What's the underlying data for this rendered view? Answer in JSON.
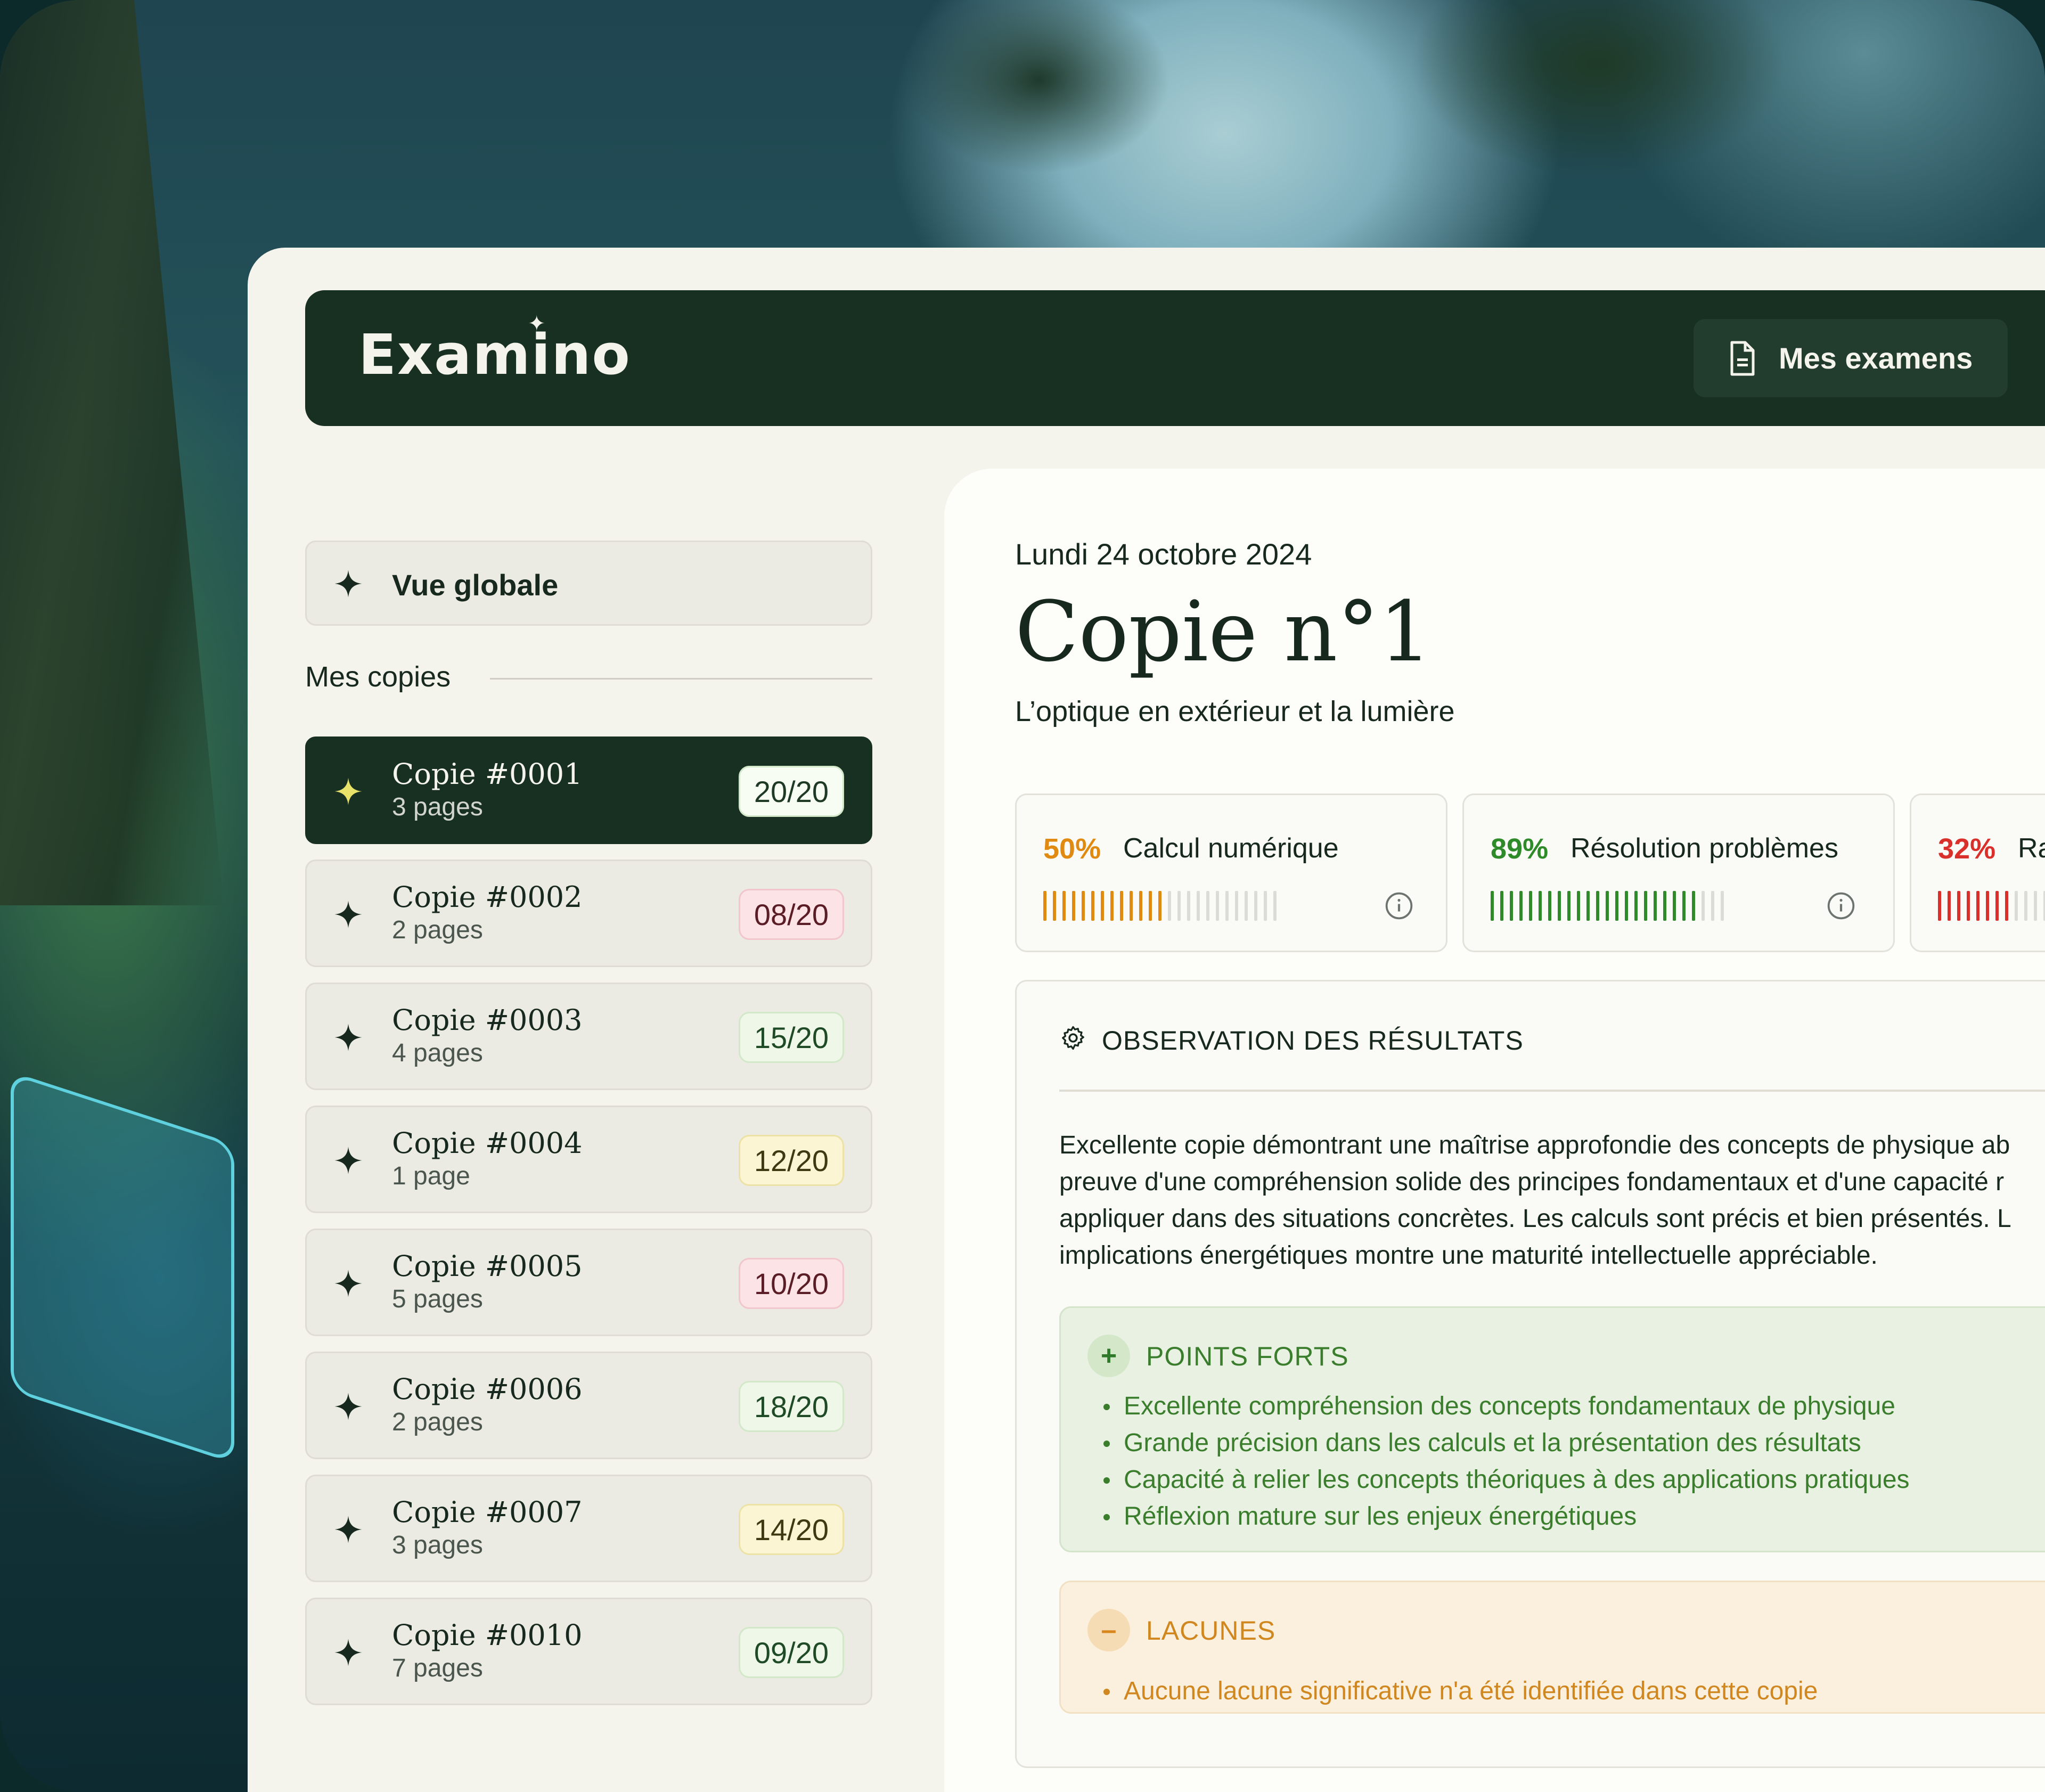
{
  "app": {
    "logo": "Examino",
    "header_button": "Mes examens"
  },
  "sidebar": {
    "overview_label": "Vue globale",
    "section_title": "Mes copies",
    "copies": [
      {
        "name": "Copie #0001",
        "pages": "3 pages",
        "grade": "20/20",
        "grade_style": "white",
        "active": true
      },
      {
        "name": "Copie #0002",
        "pages": "2 pages",
        "grade": "08/20",
        "grade_style": "pink",
        "active": false
      },
      {
        "name": "Copie #0003",
        "pages": "4 pages",
        "grade": "15/20",
        "grade_style": "green",
        "active": false
      },
      {
        "name": "Copie #0004",
        "pages": "1 page",
        "grade": "12/20",
        "grade_style": "yellow",
        "active": false
      },
      {
        "name": "Copie #0005",
        "pages": "5 pages",
        "grade": "10/20",
        "grade_style": "pink",
        "active": false
      },
      {
        "name": "Copie #0006",
        "pages": "2 pages",
        "grade": "18/20",
        "grade_style": "green",
        "active": false
      },
      {
        "name": "Copie #0007",
        "pages": "3 pages",
        "grade": "14/20",
        "grade_style": "yellow",
        "active": false
      },
      {
        "name": "Copie #0010",
        "pages": "7 pages",
        "grade": "09/20",
        "grade_style": "green",
        "active": false
      }
    ]
  },
  "main": {
    "date": "Lundi 24 octobre 2024",
    "title": "Copie n°1",
    "subtitle": "L’optique en extérieur et la lumière",
    "metrics": [
      {
        "percent": "50%",
        "label": "Calcul numérique",
        "value": 0.5,
        "color": "#e08a12"
      },
      {
        "percent": "89%",
        "label": "Résolution problèmes",
        "value": 0.89,
        "color": "#2f8a2a"
      },
      {
        "percent": "32%",
        "label": "Ra",
        "value": 0.32,
        "color": "#d9302c"
      }
    ],
    "observation": {
      "title": "OBSERVATION DES RÉSULTATS",
      "text": "Excellente copie démontrant une maîtrise approfondie des concepts de physique ab\npreuve d'une compréhension solide des principes fondamentaux et d'une capacité r\nappliquer dans des situations concrètes. Les calculs sont précis et bien présentés. L\nimplications énergétiques montre une maturité intellectuelle appréciable."
    },
    "strengths": {
      "title": "POINTS FORTS",
      "items": [
        "Excellente compréhension des concepts fondamentaux de physique",
        "Grande précision dans les calculs et la présentation des résultats",
        "Capacité à relier les concepts théoriques à des applications pratiques",
        "Réflexion mature sur les enjeux énergétiques"
      ]
    },
    "gaps": {
      "title": "LACUNES",
      "items": [
        "Aucune lacune significative n'a été identifiée dans cette copie"
      ]
    }
  },
  "colors": {
    "brand_dark": "#183022",
    "background": "#f4f3ec",
    "active_star": "#e8e26a"
  }
}
